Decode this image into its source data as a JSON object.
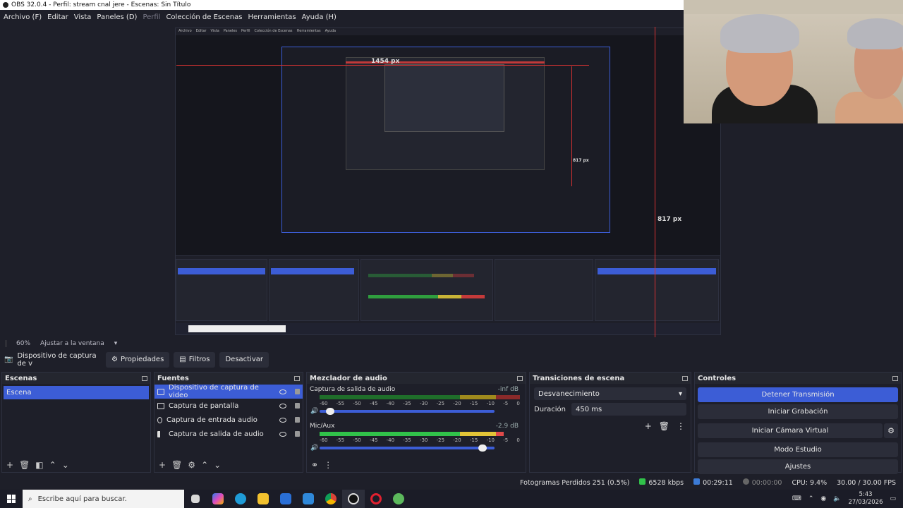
{
  "window": {
    "title": "OBS 32.0.4 - Perfil: stream cnal jere - Escenas: Sin Título"
  },
  "menu": [
    {
      "label": "Archivo (F)",
      "disabled": false
    },
    {
      "label": "Editar",
      "disabled": false
    },
    {
      "label": "Vista",
      "disabled": false
    },
    {
      "label": "Paneles (D)",
      "disabled": false
    },
    {
      "label": "Perfil",
      "disabled": true
    },
    {
      "label": "Colección de Escenas",
      "disabled": false
    },
    {
      "label": "Herramientas",
      "disabled": false
    },
    {
      "label": "Ayuda (H)",
      "disabled": false
    }
  ],
  "preview": {
    "measure_width": "1454 px",
    "measure_height_outer": "817 px",
    "measure_height_inner": "817 px"
  },
  "zoom": {
    "level": "60%",
    "fit_label": "Ajustar a la ventana"
  },
  "context": {
    "source_name": "Dispositivo de captura de v",
    "properties_label": "Propiedades",
    "filters_label": "Filtros",
    "deactivate_label": "Desactivar"
  },
  "scenes": {
    "title": "Escenas",
    "items": [
      "Escena"
    ]
  },
  "sources": {
    "title": "Fuentes",
    "items": [
      {
        "label": "Dispositivo de captura de video",
        "icon": "camera-icon",
        "selected": true
      },
      {
        "label": "Captura de pantalla",
        "icon": "monitor-icon",
        "selected": false
      },
      {
        "label": "Captura de entrada audio",
        "icon": "microphone-icon",
        "selected": false
      },
      {
        "label": "Captura de salida de audio",
        "icon": "speaker-icon",
        "selected": false
      }
    ]
  },
  "mixer": {
    "title": "Mezclador de audio",
    "channels": [
      {
        "name": "Captura de salida de audio",
        "db": "-inf dB",
        "level": 0.0,
        "volume": 0.06,
        "live": false
      },
      {
        "name": "Mic/Aux",
        "db": "-2.9 dB",
        "level": 0.92,
        "volume": 0.93,
        "live": true
      }
    ],
    "ticks": [
      "-60",
      "-55",
      "-50",
      "-45",
      "-40",
      "-35",
      "-30",
      "-25",
      "-20",
      "-15",
      "-10",
      "-5",
      "0"
    ]
  },
  "transitions": {
    "title": "Transiciones de escena",
    "selected": "Desvanecimiento",
    "duration_label": "Duración",
    "duration_value": "450 ms"
  },
  "controls": {
    "title": "Controles",
    "stop_stream": "Detener Transmisión",
    "start_recording": "Iniciar Grabación",
    "start_virtual_cam": "Iniciar Cámara Virtual",
    "studio_mode": "Modo Estudio",
    "settings": "Ajustes"
  },
  "status": {
    "dropped_frames": "Fotogramas Perdidos 251 (0.5%)",
    "bitrate": "6528 kbps",
    "stream_time": "00:29:11",
    "rec_time": "00:00:00",
    "cpu": "CPU: 9.4%",
    "fps": "30.00 / 30.00 FPS"
  },
  "taskbar": {
    "search_placeholder": "Escribe aquí para buscar.",
    "time": "5:43",
    "date": "27/03/2026",
    "apps": [
      "task-view-icon",
      "copilot-icon",
      "edge-icon",
      "explorer-icon",
      "store-icon",
      "mail-icon",
      "chrome-icon",
      "obs-icon",
      "opera-icon",
      "app-green-icon"
    ]
  },
  "colors": {
    "accent": "#3c5dd6",
    "bg": "#1e1f29",
    "meter_green": "#31c24a",
    "meter_yellow": "#e3c437",
    "meter_red": "#e04a4a",
    "measure_red": "#d93232"
  }
}
